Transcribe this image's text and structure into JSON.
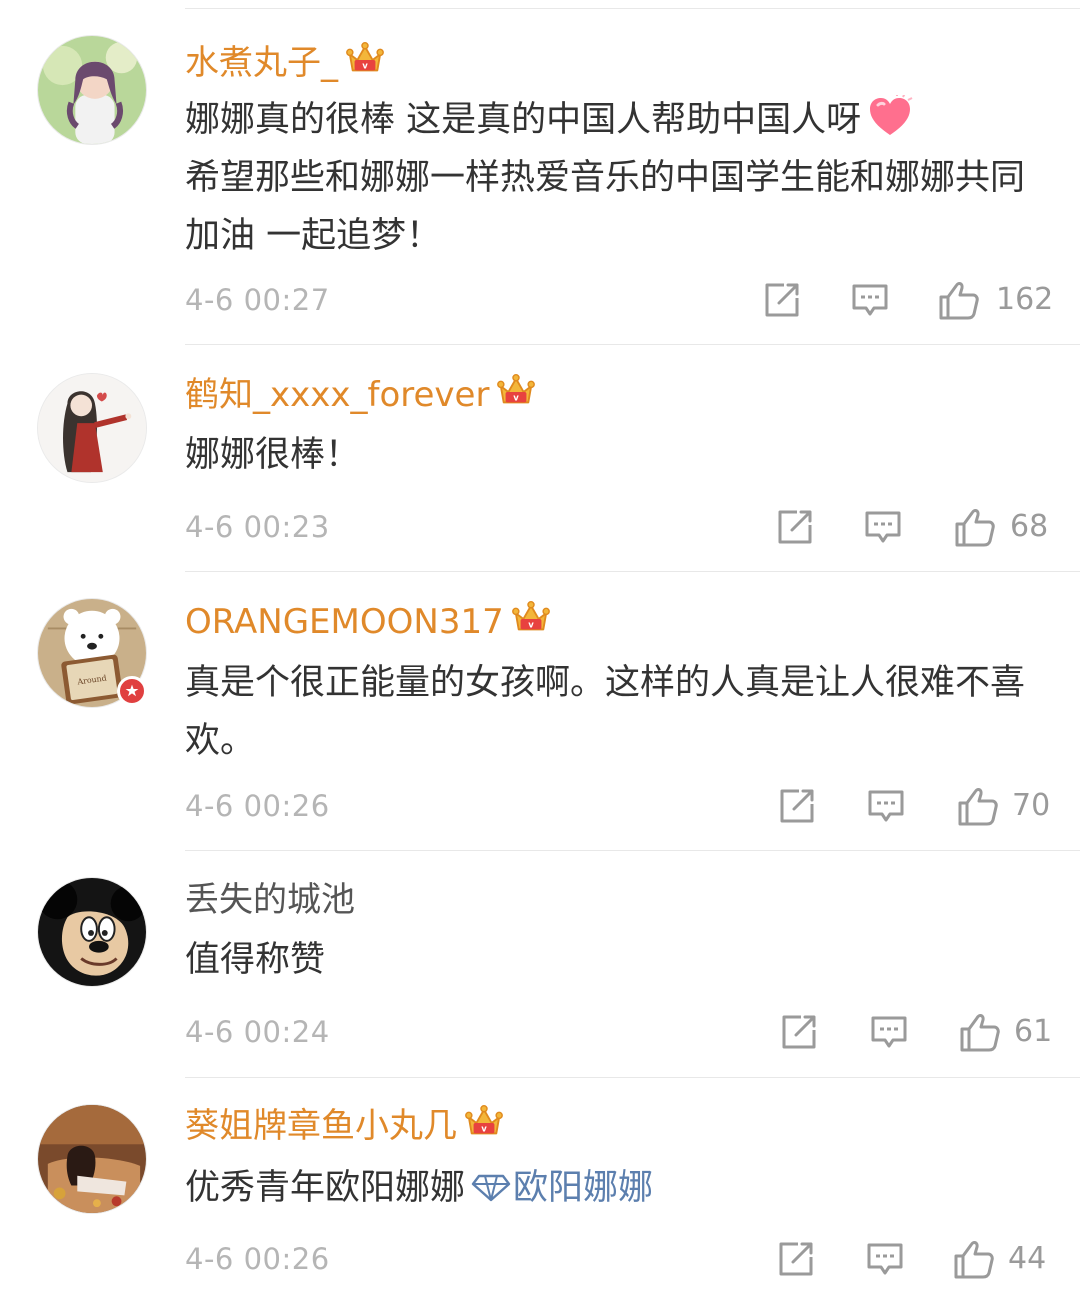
{
  "comments": [
    {
      "username": "水煮丸子_",
      "text": "娜娜真的很棒 这是真的中国人帮助中国人呀",
      "text_line2": "希望那些和娜娜一样热爱音乐的中国学生能和娜娜共同加油 一起追梦！",
      "time": "4-6 00:27",
      "likes": "162"
    },
    {
      "username": "鹤知_xxxx_forever",
      "text": "娜娜很棒！",
      "time": "4-6 00:23",
      "likes": "68"
    },
    {
      "username": "ORANGEMOON317",
      "text": "真是个很正能量的女孩啊。这样的人真是让人很难不喜欢。",
      "time": "4-6 00:26",
      "likes": "70"
    },
    {
      "username": "丢失的城池",
      "text": "值得称赞",
      "time": "4-6 00:24",
      "likes": "61"
    },
    {
      "username": "葵姐牌章鱼小丸几",
      "text": "优秀青年欧阳娜娜",
      "link": "欧阳娜娜",
      "time": "4-6 00:26",
      "likes": "44"
    }
  ],
  "icons": {
    "crown": "vip-crown-icon",
    "repost": "repost-icon",
    "comment": "comment-icon",
    "like": "thumbs-up-icon",
    "heart": "heart-emoji-icon",
    "diamond": "diamond-icon",
    "badge": "verified-badge-icon"
  },
  "colors": {
    "username_vip": "#e0892a",
    "username_plain": "#555555",
    "text": "#333333",
    "meta": "#b5b5b5",
    "link": "#5c7fae"
  }
}
